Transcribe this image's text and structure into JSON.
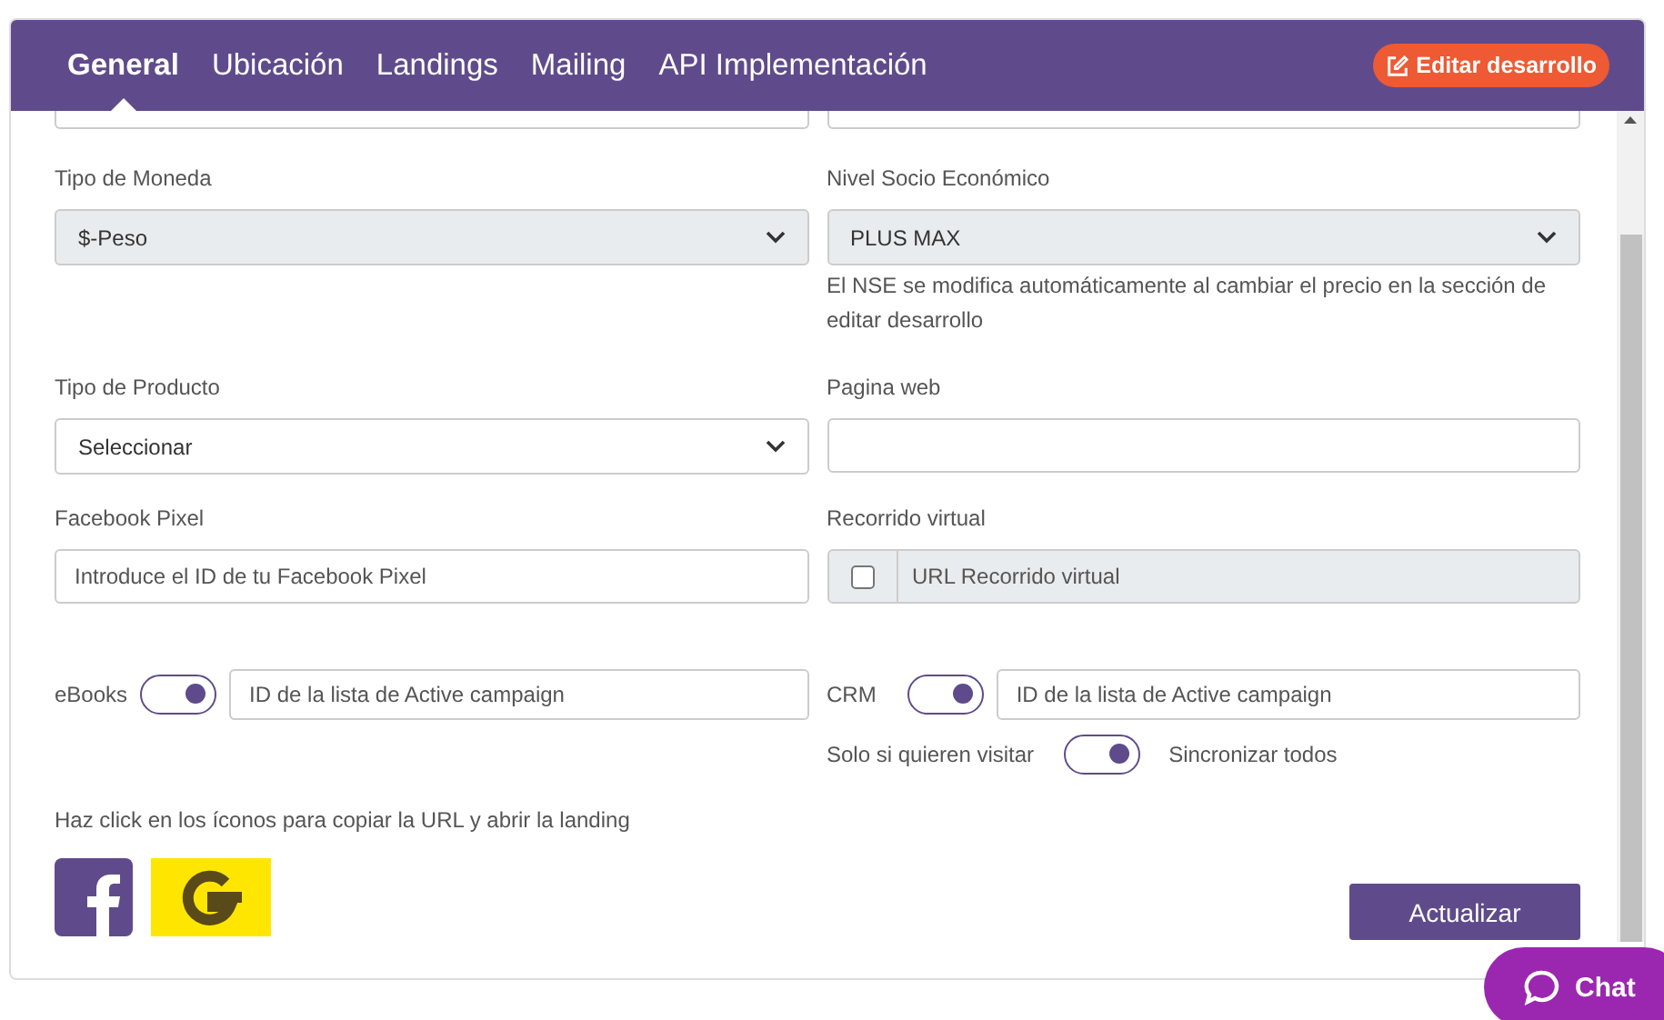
{
  "tabs": [
    {
      "label": "General",
      "selected": true
    },
    {
      "label": "Ubicación",
      "selected": false
    },
    {
      "label": "Landings",
      "selected": false
    },
    {
      "label": "Mailing",
      "selected": false
    },
    {
      "label": "API Implementación",
      "selected": false
    }
  ],
  "edit_button": {
    "label": "Editar desarrollo"
  },
  "currency": {
    "label": "Tipo de Moneda",
    "value": "$-Peso",
    "disabled": true
  },
  "nse": {
    "label": "Nivel Socio Económico",
    "value": "PLUS MAX",
    "disabled": true,
    "help": "El NSE se modifica automáticamente al cambiar el precio en la sección de editar desarrollo"
  },
  "product_type": {
    "label": "Tipo de Producto",
    "value": "Seleccionar"
  },
  "website": {
    "label": "Pagina web"
  },
  "facebook_pixel": {
    "label": "Facebook Pixel",
    "placeholder": "Introduce el ID de tu Facebook Pixel"
  },
  "virtual_tour": {
    "label": "Recorrido virtual",
    "checked": false,
    "placeholder": "URL Recorrido virtual"
  },
  "ebooks": {
    "label": "eBooks",
    "on": true,
    "placeholder": "ID de la lista de Active campaign"
  },
  "crm": {
    "label": "CRM",
    "on": true,
    "placeholder": "ID de la lista de Active campaign"
  },
  "sync": {
    "left_label": "Solo si quieren visitar",
    "on": true,
    "right_label": "Sincronizar todos"
  },
  "landing_hint": "Haz click en los íconos para copiar la URL y abrir la landing",
  "submit": {
    "label": "Actualizar"
  },
  "chat": {
    "label": "Chat"
  }
}
